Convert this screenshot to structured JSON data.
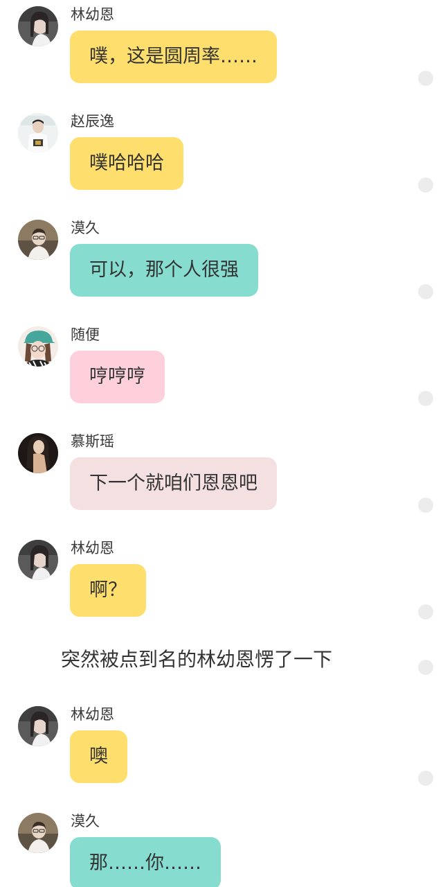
{
  "colors": {
    "yellow": "#fede6c",
    "teal": "#86dccf",
    "pink": "#fdd0dc",
    "rose": "#f4dfe1",
    "dot": "#ececec"
  },
  "messages": [
    {
      "sender": "林幼恩",
      "text": "噗，这是圆周率……",
      "color": "yellow",
      "avatar": "avatar-lin"
    },
    {
      "sender": "赵辰逸",
      "text": "噗哈哈哈",
      "color": "yellow",
      "avatar": "avatar-zhao"
    },
    {
      "sender": "漠久",
      "text": "可以，那个人很强",
      "color": "teal",
      "avatar": "avatar-mo"
    },
    {
      "sender": "随便",
      "text": "哼哼哼",
      "color": "pink",
      "avatar": "avatar-sui"
    },
    {
      "sender": "慕斯瑶",
      "text": "下一个就咱们恩恩吧",
      "color": "rose",
      "avatar": "avatar-mu"
    },
    {
      "sender": "林幼恩",
      "text": "啊？",
      "color": "yellow",
      "avatar": "avatar-lin"
    },
    {
      "sender": "林幼恩",
      "text": "噢",
      "color": "yellow",
      "avatar": "avatar-lin"
    },
    {
      "sender": "漠久",
      "text": "那……你……",
      "color": "teal",
      "avatar": "avatar-mo"
    }
  ],
  "narration": "突然被点到名的林幼恩愣了一下"
}
